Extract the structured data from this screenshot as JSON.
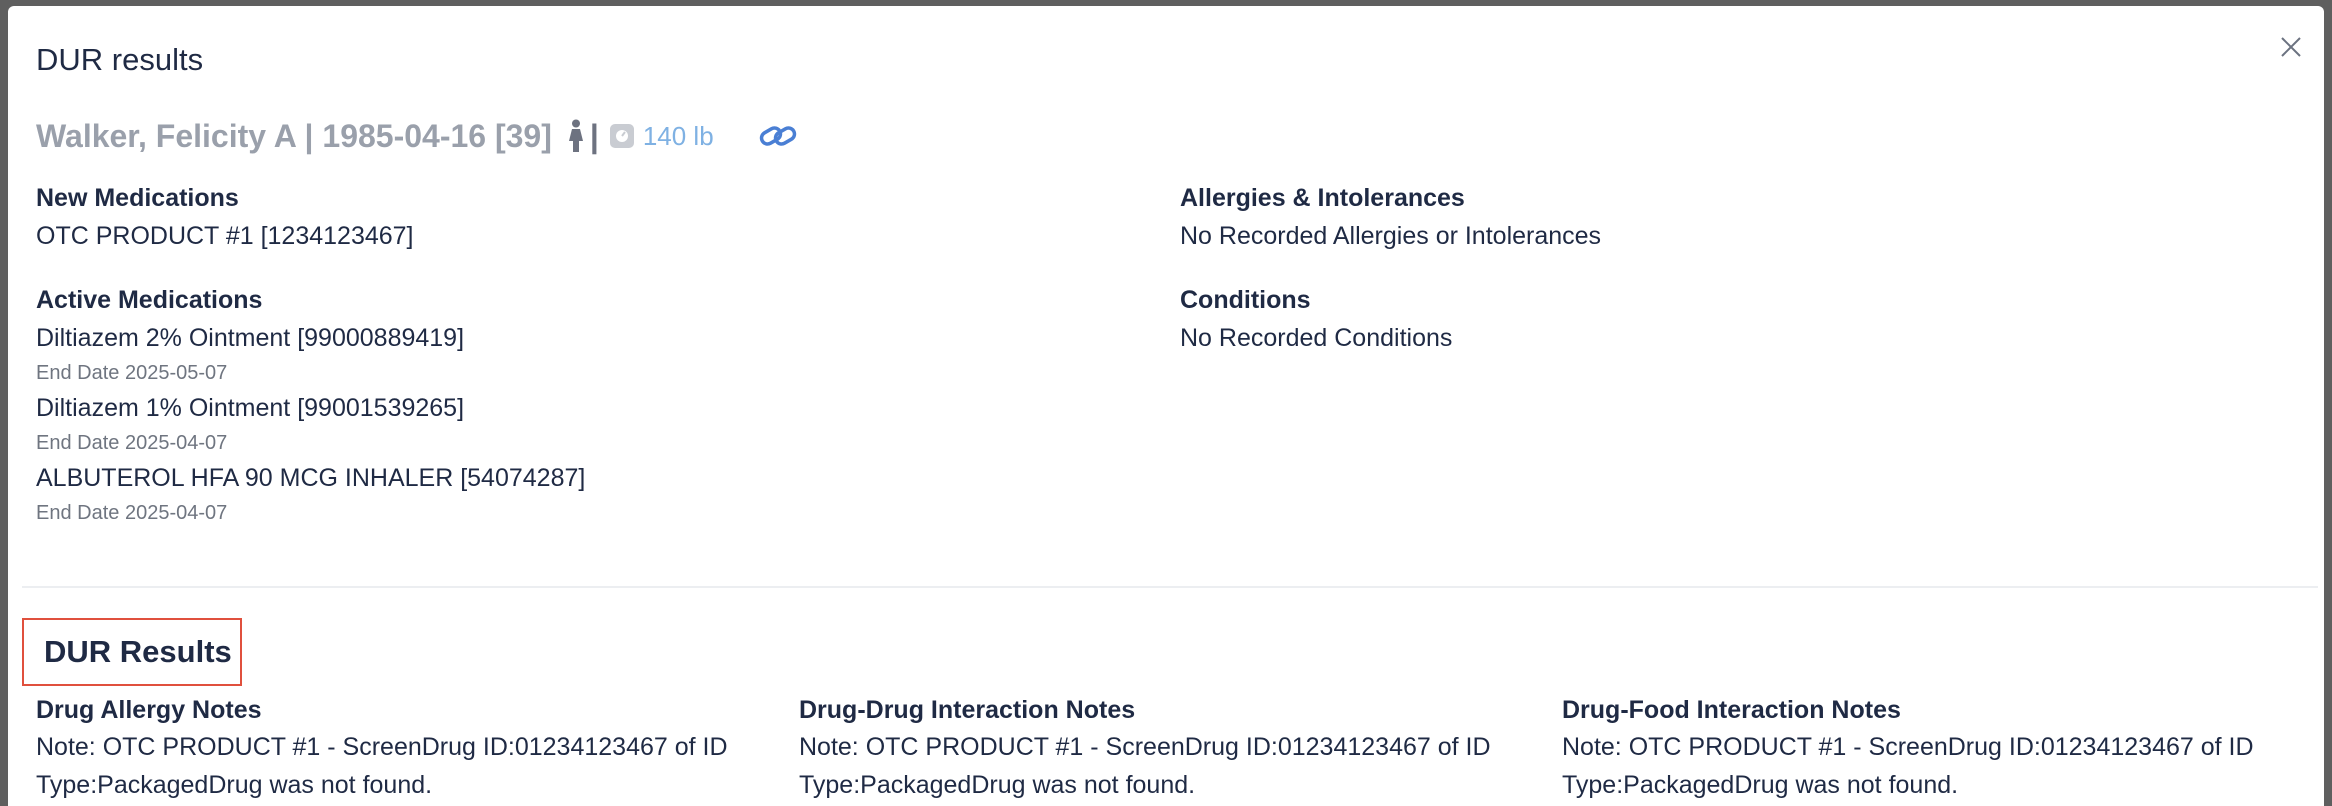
{
  "modal": {
    "title": "DUR results",
    "close_icon": "close-icon"
  },
  "patient": {
    "name_dob": "Walker, Felicity A | 1985-04-16 [39]",
    "sex_icon": "female-person-icon",
    "separator": "|",
    "scale_icon": "scale-icon",
    "weight": "140 lb",
    "link_icon": "link-icon"
  },
  "new_medications": {
    "label": "New Medications",
    "items": [
      "OTC PRODUCT #1 [1234123467]"
    ]
  },
  "allergies": {
    "label": "Allergies & Intolerances",
    "value": "No Recorded Allergies or Intolerances"
  },
  "active_medications": {
    "label": "Active Medications",
    "items": [
      {
        "name": "Diltiazem 2% Ointment [99000889419]",
        "end_date": "End Date 2025-05-07"
      },
      {
        "name": "Diltiazem 1% Ointment [99001539265]",
        "end_date": "End Date 2025-04-07"
      },
      {
        "name": "ALBUTEROL HFA 90 MCG INHALER [54074287]",
        "end_date": "End Date 2025-04-07"
      }
    ]
  },
  "conditions": {
    "label": "Conditions",
    "value": "No Recorded Conditions"
  },
  "dur_results": {
    "title": "DUR Results",
    "columns": [
      {
        "label": "Drug Allergy Notes",
        "note": "Note: OTC PRODUCT #1 - ScreenDrug ID:01234123467 of ID Type:PackagedDrug was not found."
      },
      {
        "label": "Drug-Drug Interaction Notes",
        "note": "Note: OTC PRODUCT #1 - ScreenDrug ID:01234123467 of ID Type:PackagedDrug was not found."
      },
      {
        "label": "Drug-Food Interaction Notes",
        "note": "Note: OTC PRODUCT #1 - ScreenDrug ID:01234123467 of ID Type:PackagedDrug was not found."
      }
    ]
  },
  "colors": {
    "title_text": "#1f2a44",
    "patient_name": "#9aa0ab",
    "weight": "#7fb1e3",
    "link": "#4a7fd4",
    "highlight_box": "#e0503d"
  }
}
